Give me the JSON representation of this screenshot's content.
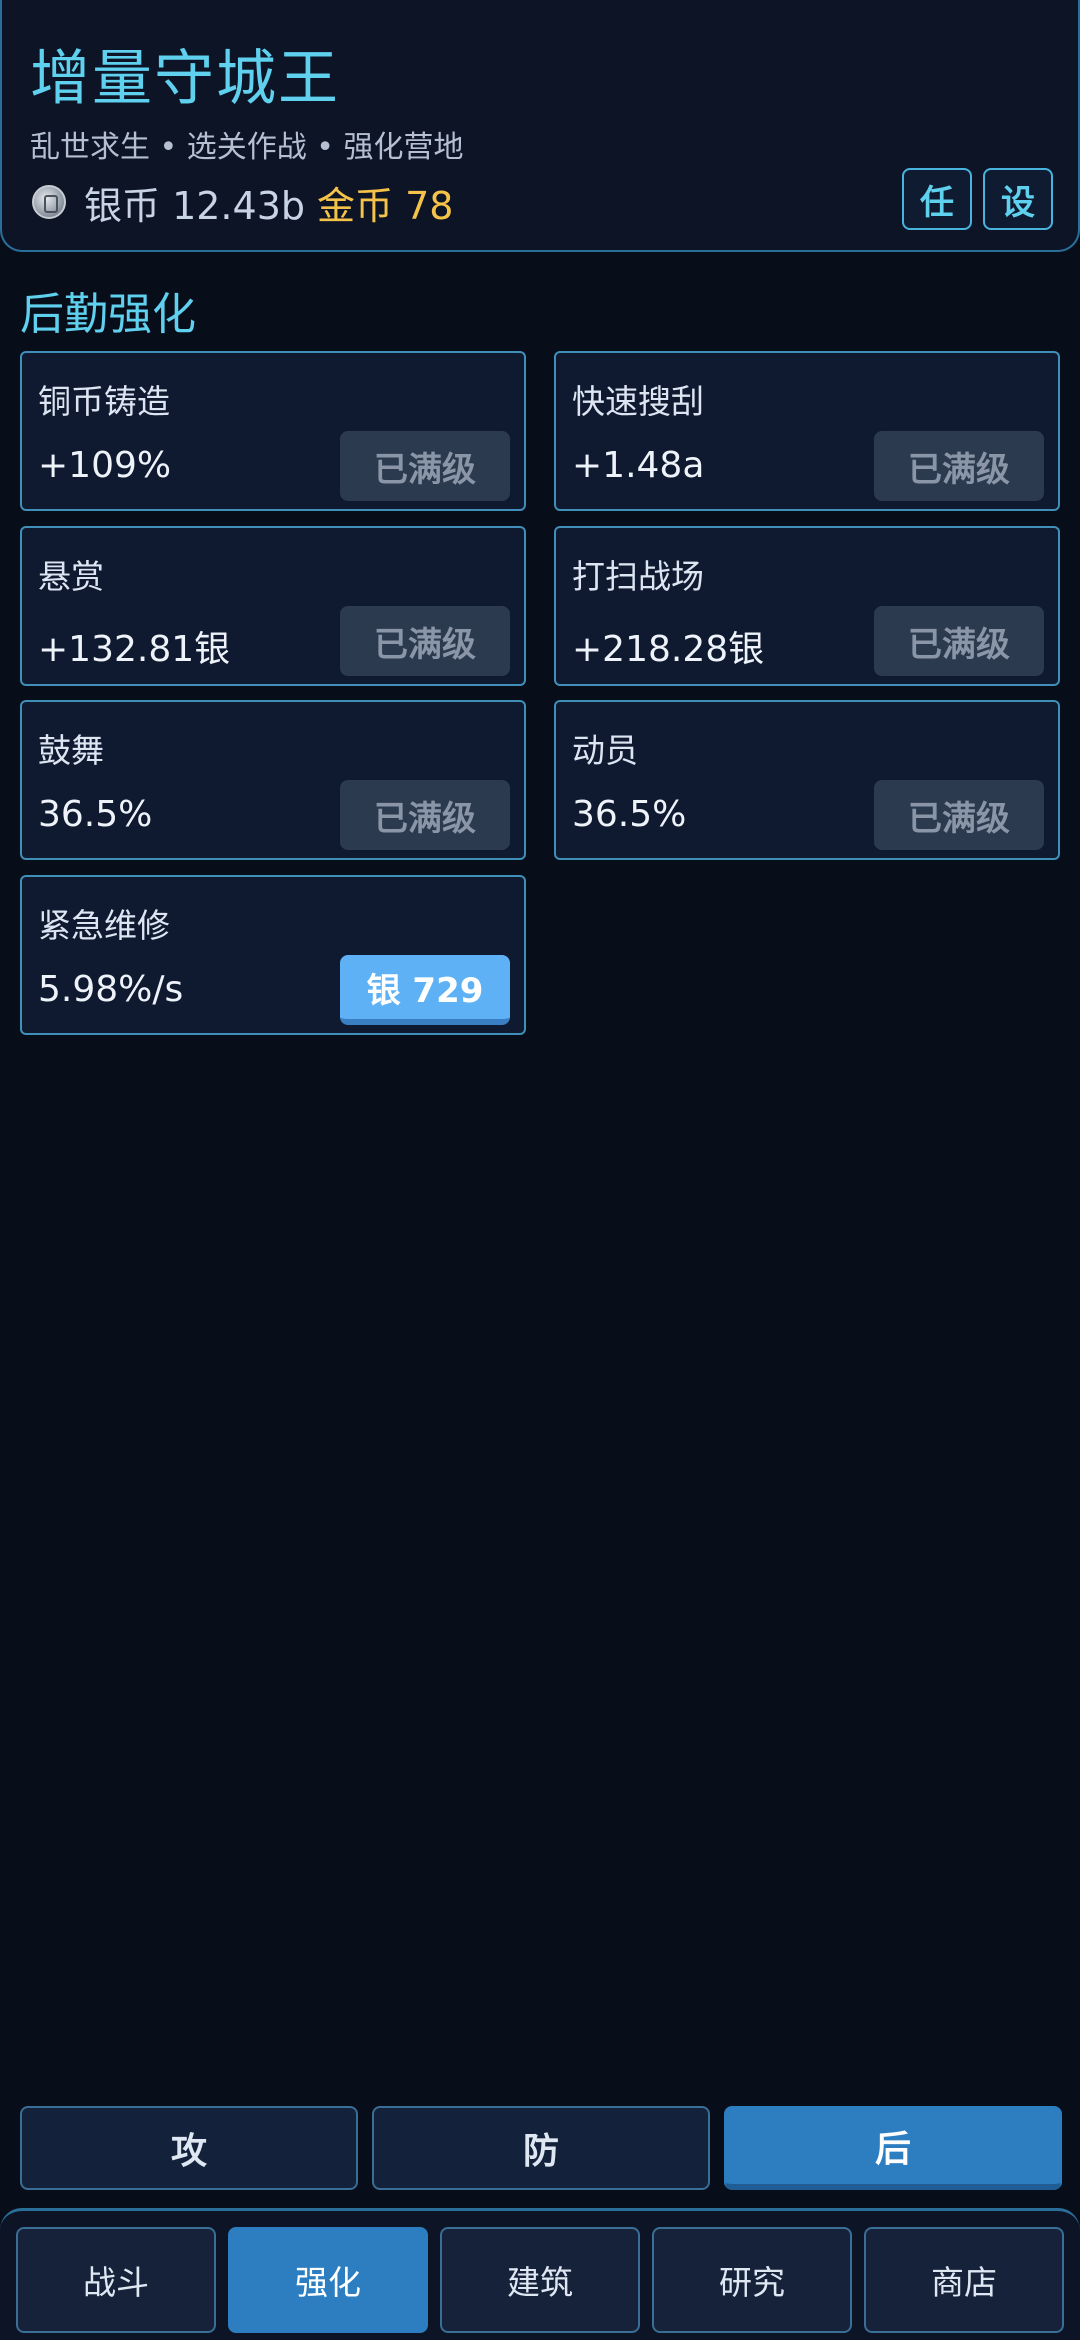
{
  "header": {
    "title": "增量守城王",
    "subtitle": "乱世求生 • 选关作战 • 强化营地",
    "silver": "银币 12.43b",
    "gold": "金币 78",
    "tasks_button": "任",
    "settings_button": "设",
    "coin_icon": "silver-coin-icon"
  },
  "section": {
    "title": "后勤强化",
    "upgrades": [
      {
        "name": "铜币铸造",
        "value": "+109%",
        "button": "已满级"
      },
      {
        "name": "快速搜刮",
        "value": "+1.48a",
        "button": "已满级"
      },
      {
        "name": "悬赏",
        "value": "+132.81银",
        "button": "已满级"
      },
      {
        "name": "打扫战场",
        "value": "+218.28银",
        "button": "已满级"
      },
      {
        "name": "鼓舞",
        "value": "36.5%",
        "button": "已满级"
      },
      {
        "name": "动员",
        "value": "36.5%",
        "button": "已满级"
      },
      {
        "name": "紧急维修",
        "value": "5.98%/s",
        "button": "银 729"
      }
    ]
  },
  "categories": [
    {
      "label": "攻"
    },
    {
      "label": "防"
    },
    {
      "label": "后",
      "active": true
    }
  ],
  "nav": [
    {
      "label": "战斗"
    },
    {
      "label": "强化",
      "active": true
    },
    {
      "label": "建筑"
    },
    {
      "label": "研究"
    },
    {
      "label": "商店"
    }
  ],
  "colors": {
    "accent": "#5fd0ee",
    "gold": "#f6c34a",
    "active": "#2c7ec0",
    "buy": "#5eb1f4",
    "background": "#080d1a"
  }
}
